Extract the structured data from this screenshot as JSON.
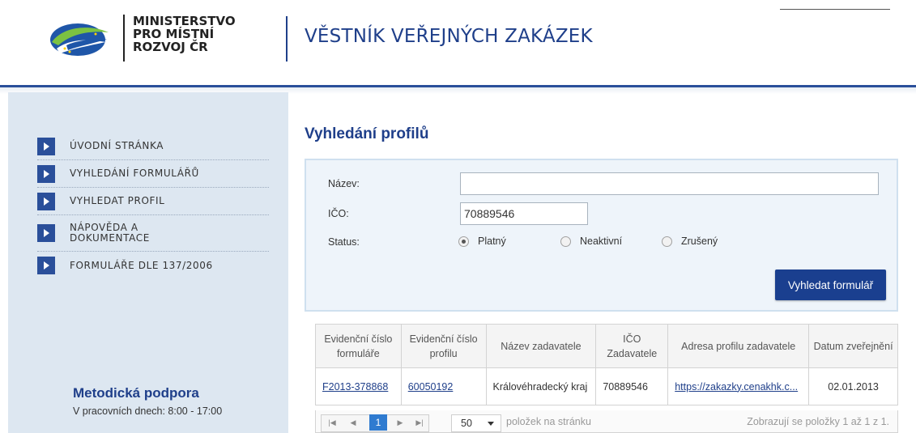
{
  "header": {
    "ministry_lines": [
      "MINISTERSTVO",
      "PRO MÍSTNÍ",
      "ROZVOJ ČR"
    ],
    "site_title": "VĚSTNÍK VEŘEJNÝCH ZAKÁZEK"
  },
  "sidebar": {
    "items": [
      {
        "label": "ÚVODNÍ STRÁNKA"
      },
      {
        "label": "VYHLEDÁNÍ FORMULÁŘŮ"
      },
      {
        "label": "VYHLEDAT PROFIL"
      },
      {
        "label": "NÁPOVĚDA A DOKUMENTACE"
      },
      {
        "label": "FORMULÁŘE DLE 137/2006"
      }
    ],
    "support_title": "Metodická podpora",
    "support_hours": "V pracovních dnech: 8:00 - 17:00"
  },
  "main": {
    "title": "Vyhledání profilů",
    "form": {
      "name_label": "Název:",
      "name_value": "",
      "ico_label": "IČO:",
      "ico_value": "70889546",
      "status_label": "Status:",
      "status_options": [
        {
          "label": "Platný",
          "checked": true
        },
        {
          "label": "Neaktivní",
          "checked": false
        },
        {
          "label": "Zrušený",
          "checked": false
        }
      ],
      "search_button": "Vyhledat formulář"
    },
    "table": {
      "headers": [
        "Evidenční číslo formuláře",
        "Evidenční číslo profilu",
        "Název zadavatele",
        "IČO Zadavatele",
        "Adresa profilu zadavatele",
        "Datum zveřejnění"
      ],
      "rows": [
        [
          "F2013-378868",
          "60050192",
          "Královéhradecký kraj",
          "70889546",
          "https://zakazky.cenakhk.c...",
          "02.01.2013"
        ]
      ]
    },
    "pager": {
      "current_page": "1",
      "page_size": "50",
      "page_size_label": "položek na stránku",
      "info": "Zobrazují se položky 1 až 1 z 1."
    }
  },
  "colors": {
    "brand_blue": "#1f3f8a",
    "sidebar_bg": "#dde7f1",
    "form_bg": "#eef4fa",
    "pager_active": "#2f7bd0"
  }
}
